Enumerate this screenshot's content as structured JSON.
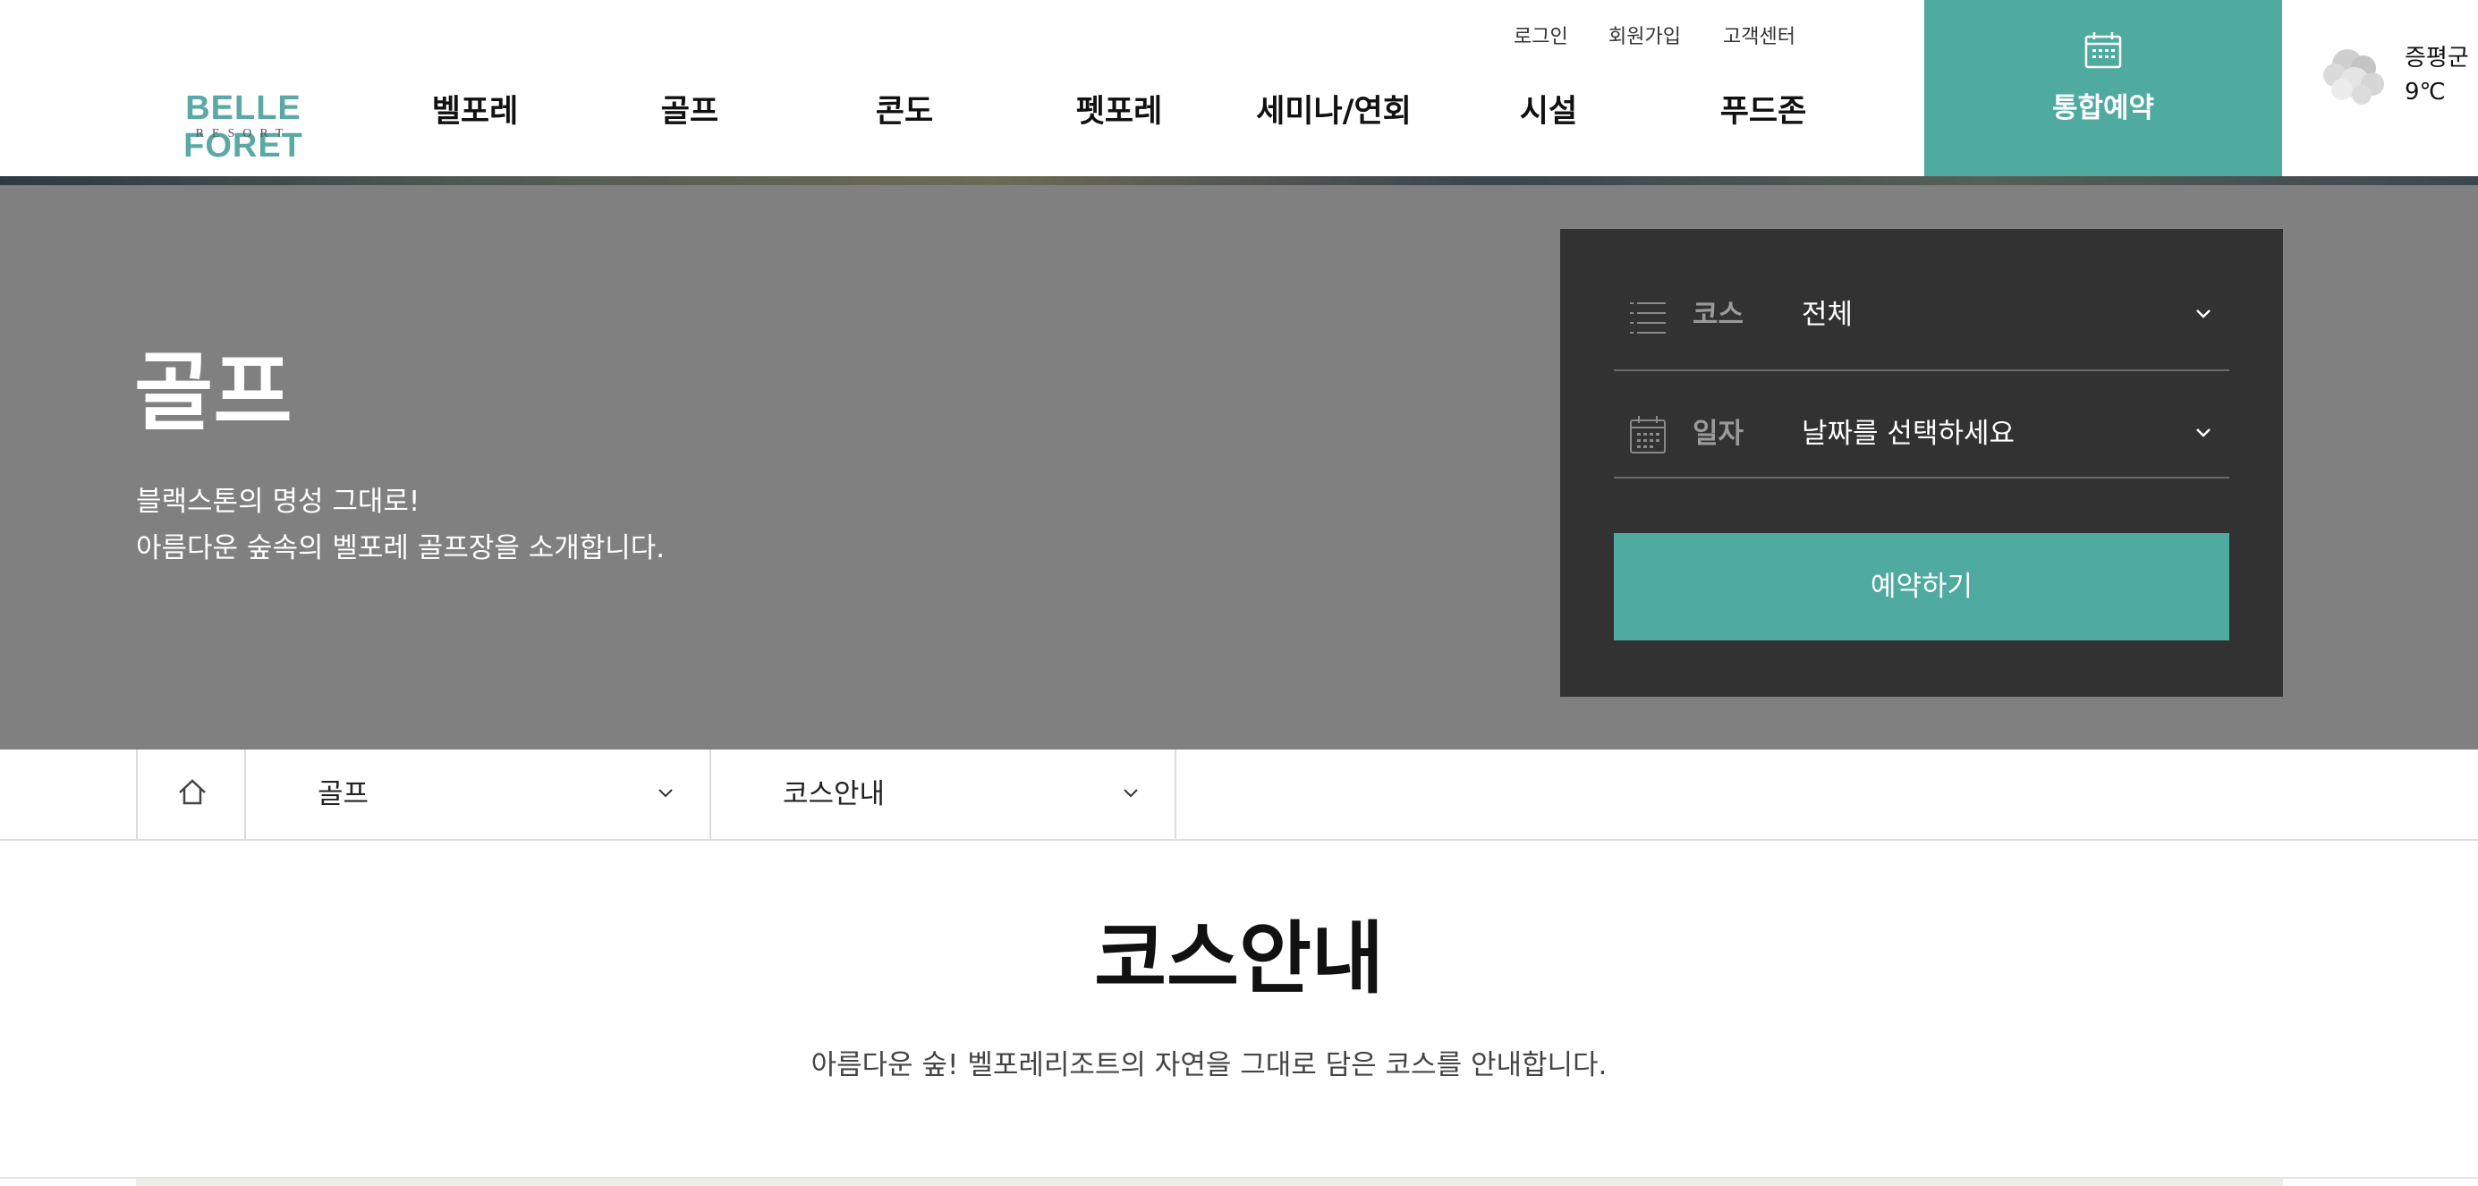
{
  "brand": {
    "logo_main": "BELLE FORET",
    "logo_sub": "RESORT",
    "accent_color": "#4faaa0"
  },
  "header": {
    "util_links": [
      "로그인",
      "회원가입",
      "고객센터"
    ],
    "nav": [
      "벨포레",
      "골프",
      "콘도",
      "펫포레",
      "세미나/연회",
      "시설",
      "푸드존"
    ],
    "reserve_label": "통합예약",
    "reserve_icon": "calendar-icon"
  },
  "weather": {
    "location": "증평군",
    "temp": "9℃",
    "icon": "cloud-icon"
  },
  "hero": {
    "title": "골프",
    "desc_line1": "블랙스톤의 명성 그대로!",
    "desc_line2": "아름다운 숲속의 벨포레 골프장을 소개합니다."
  },
  "booking": {
    "course_label": "코스",
    "course_value": "전체",
    "date_label": "일자",
    "date_value": "날짜를 선택하세요",
    "submit_label": "예약하기"
  },
  "breadcrumb": {
    "home_icon": "home-icon",
    "level1": "골프",
    "level2": "코스안내"
  },
  "content": {
    "title": "코스안내",
    "description": "아름다운 숲! 벨포레리조트의 자연을 그대로 담은 코스를 안내합니다."
  }
}
